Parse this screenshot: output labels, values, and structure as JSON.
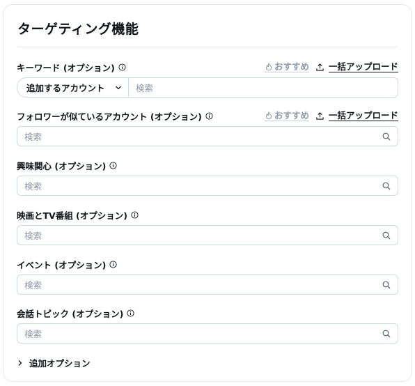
{
  "section": {
    "title": "ターゲティング機能"
  },
  "common": {
    "recommend_label": "おすすめ",
    "bulk_upload_label": "一括アップロード",
    "search_placeholder": "検索"
  },
  "fields": [
    {
      "label": "キーワード (オプション)",
      "has_actions": true,
      "select_label": "追加するアカウント"
    },
    {
      "label": "フォロワーが似ているアカウント (オプション)",
      "has_actions": true
    },
    {
      "label": "興味関心 (オプション)",
      "has_actions": false
    },
    {
      "label": "映画とTV番組 (オプション)",
      "has_actions": false
    },
    {
      "label": "イベント (オプション)",
      "has_actions": false
    },
    {
      "label": "会話トピック (オプション)",
      "has_actions": false
    }
  ],
  "more_options": {
    "label": "追加オプション"
  },
  "icons": {
    "info": "info-icon",
    "recommend": "sparkle-flame-icon",
    "upload": "upload-icon",
    "search": "search-icon",
    "chevron_down": "chevron-down-icon",
    "chevron_right": "chevron-right-icon"
  },
  "colors": {
    "text": "#0f1419",
    "muted": "#8b98a5",
    "border": "#cfd9de"
  }
}
